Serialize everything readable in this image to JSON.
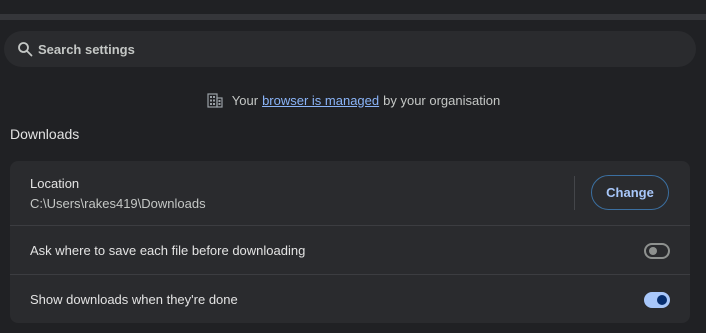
{
  "search": {
    "placeholder": "Search settings",
    "icon": "search-icon"
  },
  "managed_notice": {
    "icon": "building-icon",
    "prefix": "Your",
    "link_text": "browser is managed",
    "suffix": "by your organisation"
  },
  "section": {
    "title": "Downloads"
  },
  "location": {
    "label": "Location",
    "path": "C:\\Users\\rakes419\\Downloads",
    "button_label": "Change"
  },
  "settings": [
    {
      "label": "Ask where to save each file before downloading",
      "enabled": false
    },
    {
      "label": "Show downloads when they're done",
      "enabled": true
    }
  ],
  "colors": {
    "background": "#202124",
    "card": "#2a2b2e",
    "accent": "#a8c7fa",
    "link": "#8ab4f8"
  }
}
